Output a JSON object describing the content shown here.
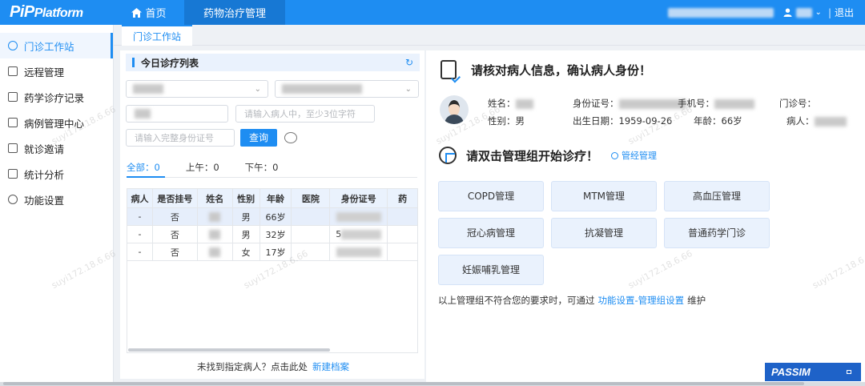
{
  "app": {
    "logo_pre": "PiP",
    "logo_post": "Platform"
  },
  "topnav": {
    "home": "首页",
    "drug_management": "药物治疗管理",
    "logout": "退出",
    "separator": "|"
  },
  "sidebar": {
    "items": [
      {
        "label": "门诊工作站",
        "icon": "user-icon"
      },
      {
        "label": "远程管理",
        "icon": "remote-icon"
      },
      {
        "label": "药学诊疗记录",
        "icon": "record-icon"
      },
      {
        "label": "病例管理中心",
        "icon": "case-icon"
      },
      {
        "label": "就诊邀请",
        "icon": "invite-icon"
      },
      {
        "label": "统计分析",
        "icon": "chart-icon"
      },
      {
        "label": "功能设置",
        "icon": "gear-icon"
      }
    ]
  },
  "tab": {
    "label": "门诊工作站"
  },
  "left": {
    "title": "今日诊疗列表",
    "search_placeholder_name": "请输入病人中，至少3位字符",
    "search_placeholder_id": "请输入完整身份证号",
    "query_label": "查询",
    "counts": {
      "all": "全部：0",
      "am": "上午：0",
      "pm": "下午：0"
    },
    "table": {
      "headers": [
        "病人",
        "是否挂号",
        "姓名",
        "性别",
        "年龄",
        "医院",
        "身份证号",
        "药"
      ],
      "rows": [
        [
          "-",
          "否",
          "",
          "男",
          "66岁",
          "",
          ""
        ],
        [
          "-",
          "否",
          "",
          "男",
          "32岁",
          "",
          "5"
        ],
        [
          "-",
          "否",
          "",
          "女",
          "17岁",
          "",
          ""
        ]
      ]
    },
    "not_found": "未找到指定病人？点击此处",
    "new_record": "新建档案"
  },
  "right": {
    "verify_title": "请核对病人信息，确认病人身份！",
    "info": {
      "name_label": "姓名：",
      "gender_label": "性别：",
      "gender_value": "男",
      "id_label": "身份证号：",
      "birth_label": "出生日期：",
      "birth_value": "1959-09-26",
      "phone_label": "手机号：",
      "age_label": "年龄：",
      "age_value": "66岁",
      "clinic_label": "门诊号：",
      "patient_label": "病人："
    },
    "manage_title": "请双击管理组开始诊疗！",
    "manage_link": "管经管理",
    "groups": [
      "COPD管理",
      "MTM管理",
      "高血压管理",
      "冠心病管理",
      "抗凝管理",
      "普通药学门诊",
      "妊娠哺乳管理"
    ],
    "note_pre": "以上管理组不符合您的要求时，可通过",
    "note_link": "功能设置-管理组设置",
    "note_post": "维护"
  },
  "badge": {
    "label": "PASSIM"
  },
  "watermark": "suyi172.18.6.66",
  "colors": {
    "primary": "#1e8df2",
    "nav_active": "#1778d4",
    "badge": "#1e62c8"
  }
}
